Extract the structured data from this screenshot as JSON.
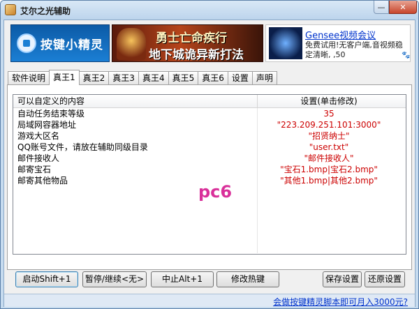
{
  "window": {
    "title": "艾尔之光辅助",
    "min_symbol": "—",
    "close_symbol": "✕"
  },
  "banner": {
    "logo_text": "按键小精灵",
    "ad_line1": "勇士亡命疾行",
    "ad_line2": "地下城诡异新打法",
    "gensee_title": "Gensee视频会议",
    "gensee_desc": "免费试用!无客户端,音视频稳定清晰, ,50"
  },
  "tabs": [
    {
      "label": "软件说明",
      "active": false
    },
    {
      "label": "真王1",
      "active": true
    },
    {
      "label": "真王2",
      "active": false
    },
    {
      "label": "真王3",
      "active": false
    },
    {
      "label": "真王4",
      "active": false
    },
    {
      "label": "真王5",
      "active": false
    },
    {
      "label": "真王6",
      "active": false
    },
    {
      "label": "设置",
      "active": false
    },
    {
      "label": "声明",
      "active": false
    }
  ],
  "list": {
    "header_name": "可以自定义的内容",
    "header_value": "设置(单击修改)",
    "rows": [
      {
        "name": "自动任务结束等级",
        "value": "35"
      },
      {
        "name": "局域网容器地址",
        "value": "\"223.209.251.101:3000\""
      },
      {
        "name": "游戏大区名",
        "value": "\"招贤纳士\""
      },
      {
        "name": "QQ账号文件，请放在辅助同级目录",
        "value": "\"user.txt\""
      },
      {
        "name": "邮件接收人",
        "value": "\"邮件接收人\""
      },
      {
        "name": "邮寄宝石",
        "value": "\"宝石1.bmp|宝石2.bmp\""
      },
      {
        "name": "邮寄其他物品",
        "value": "\"其他1.bmp|其他2.bmp\""
      }
    ]
  },
  "watermark": "pc6",
  "buttons": {
    "start": "启动Shift+1",
    "pause": "暂停/继续<无>",
    "stop": "中止Alt+1",
    "hotkey": "修改热键",
    "save": "保存设置",
    "restore": "还原设置"
  },
  "status": {
    "link_text": "会做按键精灵脚本即可月入3000元?"
  },
  "colors": {
    "value_text": "#cc0000",
    "link": "#0033cc",
    "watermark": "#d9309a"
  }
}
